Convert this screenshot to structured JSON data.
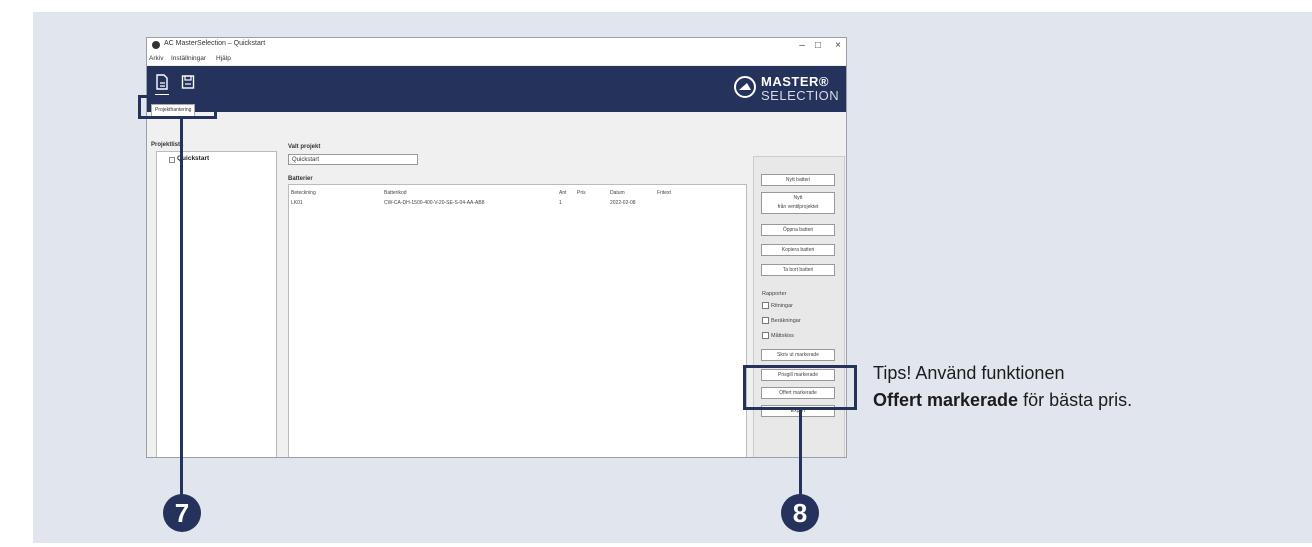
{
  "window": {
    "title": "AC MasterSelection – Quickstart",
    "menu": [
      "Arkiv",
      "Inställningar",
      "Hjälp"
    ],
    "tab_label": "Projekthantering",
    "brand_line1": "MASTER®",
    "brand_line2": "SELECTION"
  },
  "projects": {
    "header": "Projektlista",
    "node": "Quickstart"
  },
  "project_view": {
    "label": "Valt projekt",
    "value": "Quickstart"
  },
  "batteries": {
    "label": "Batterier",
    "columns": [
      "Beteckning",
      "Batterikod",
      "Ant",
      "Pris",
      "Datum",
      "Fritext"
    ],
    "rows": [
      [
        "LK01",
        "CW-CA-DH-1500-400-V-20-SE-S-04-AA-AB8",
        "1",
        "",
        "2022-02-08",
        ""
      ]
    ]
  },
  "side": {
    "buttons": [
      "Nytt batteri",
      "Nytt",
      "från ventilprojektet",
      "Öppna batteri",
      "Kopiera batteri",
      "Ta bort batteri"
    ],
    "report_label": "Rapporter",
    "checks": [
      "Ritningar",
      "Beräkningar",
      "Måttskiss"
    ],
    "buttons2": [
      "Skriv ut markerade",
      "Prisgill markerade",
      "Offert markerade",
      "Export"
    ]
  },
  "markers": [
    "7",
    "8"
  ],
  "tips": {
    "line1": "Tips! Använd funktionen",
    "bold": "Offert markerade",
    "rest": " för bästa pris."
  },
  "colors": {
    "accent": "#24325c",
    "panel_bg": "#e1e5ed"
  }
}
